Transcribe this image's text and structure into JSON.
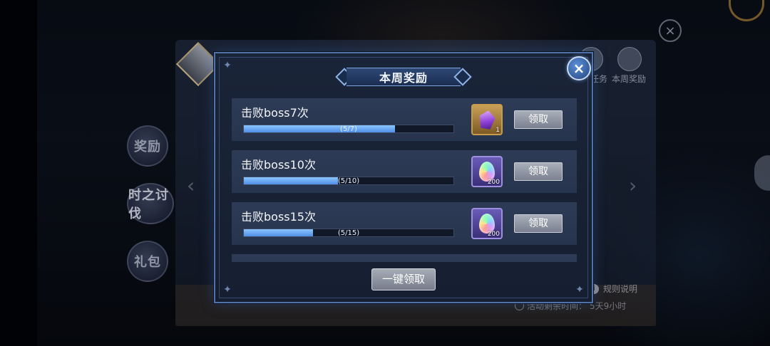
{
  "background": {
    "side_tabs": [
      "奖励",
      "时之讨伐",
      "礼包"
    ],
    "header_tabs": [
      "任务",
      "本周奖励"
    ],
    "rules_label": "规则说明",
    "timer_label": "活动剩余时间：",
    "timer_value": "5天9小时"
  },
  "dialog": {
    "title": "本周奖励",
    "close_icon": "×",
    "rewards": [
      {
        "title": "击败boss7次",
        "progress_current": 5,
        "progress_total": 7,
        "progress_text": "(5/7)",
        "progress_fraction": 0.72,
        "reward_icon": "purple-crystal",
        "reward_count": "1",
        "button_label": "领取"
      },
      {
        "title": "击败boss10次",
        "progress_current": 5,
        "progress_total": 10,
        "progress_text": "(5/10)",
        "progress_fraction": 0.45,
        "reward_icon": "rainbow-gem",
        "reward_count": "200",
        "button_label": "领取"
      },
      {
        "title": "击败boss15次",
        "progress_current": 5,
        "progress_total": 15,
        "progress_text": "(5/15)",
        "progress_fraction": 0.33,
        "reward_icon": "rainbow-gem",
        "reward_count": "200",
        "button_label": "领取"
      }
    ],
    "claim_all_label": "一键领取"
  },
  "colors": {
    "accent_blue": "#4f72a8",
    "progress_fill": "#6aaaf5",
    "button_gray": "#8f95a2"
  }
}
